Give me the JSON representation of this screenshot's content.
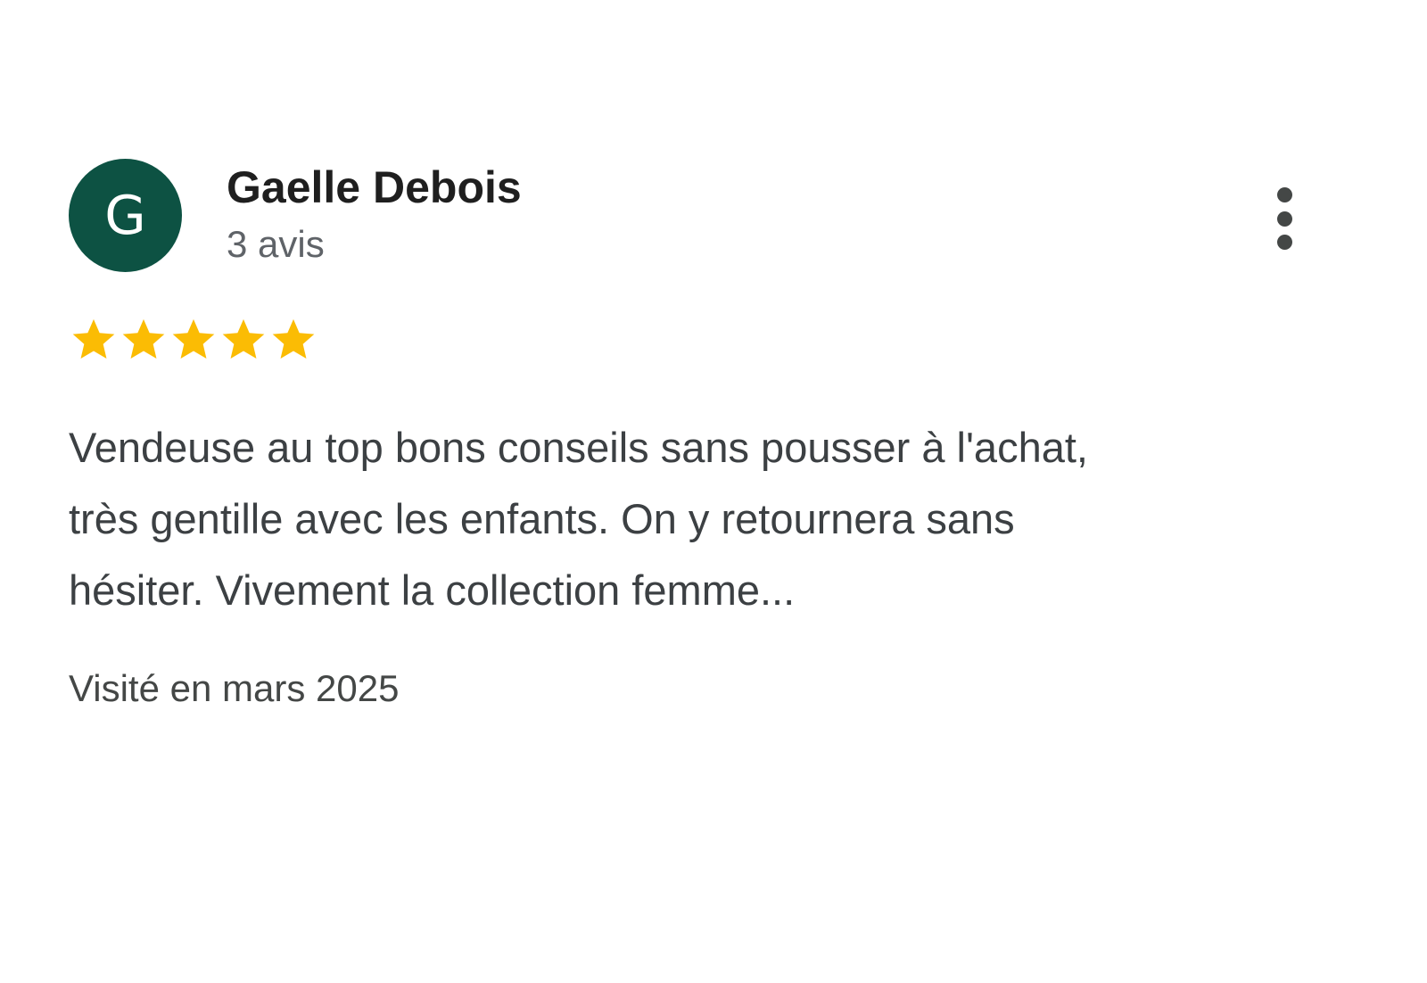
{
  "review": {
    "avatar_initial": "G",
    "avatar_color": "#0d5243",
    "author_name": "Gaelle Debois",
    "review_count": "3 avis",
    "rating": 5,
    "rating_max": 5,
    "star_color": "#fbbc04",
    "text_lines": [
      "Vendeuse au top bons conseils sans pousser à l'achat,",
      "très gentille avec les enfants. On y retournera sans",
      "hésiter. Vivement la collection femme..."
    ],
    "visit_date": "Visité en mars 2025",
    "more_icon": "more-vert-icon"
  }
}
